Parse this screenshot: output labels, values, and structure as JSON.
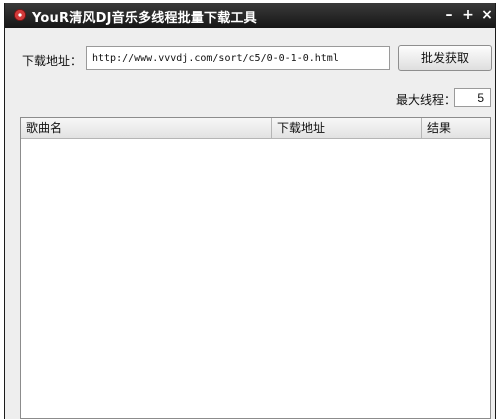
{
  "window": {
    "title": "YouR清风DJ音乐多线程批量下载工具",
    "minimize_glyph": "–",
    "maximize_glyph": "+",
    "close_glyph": "×",
    "icon": "record-disc-icon"
  },
  "form": {
    "url_label": "下载地址：",
    "url_value": "http://www.vvvdj.com/sort/c5/0-0-1-0.html",
    "fetch_button_label": "批发获取",
    "threads_label": "最大线程：",
    "threads_value": "5"
  },
  "table": {
    "columns": [
      "歌曲名",
      "下载地址",
      "结果"
    ],
    "rows": []
  },
  "colors": {
    "titlebar": "#1e1e1e",
    "window_bg": "#eeeeee",
    "accent_icon": "#d23a3a"
  }
}
